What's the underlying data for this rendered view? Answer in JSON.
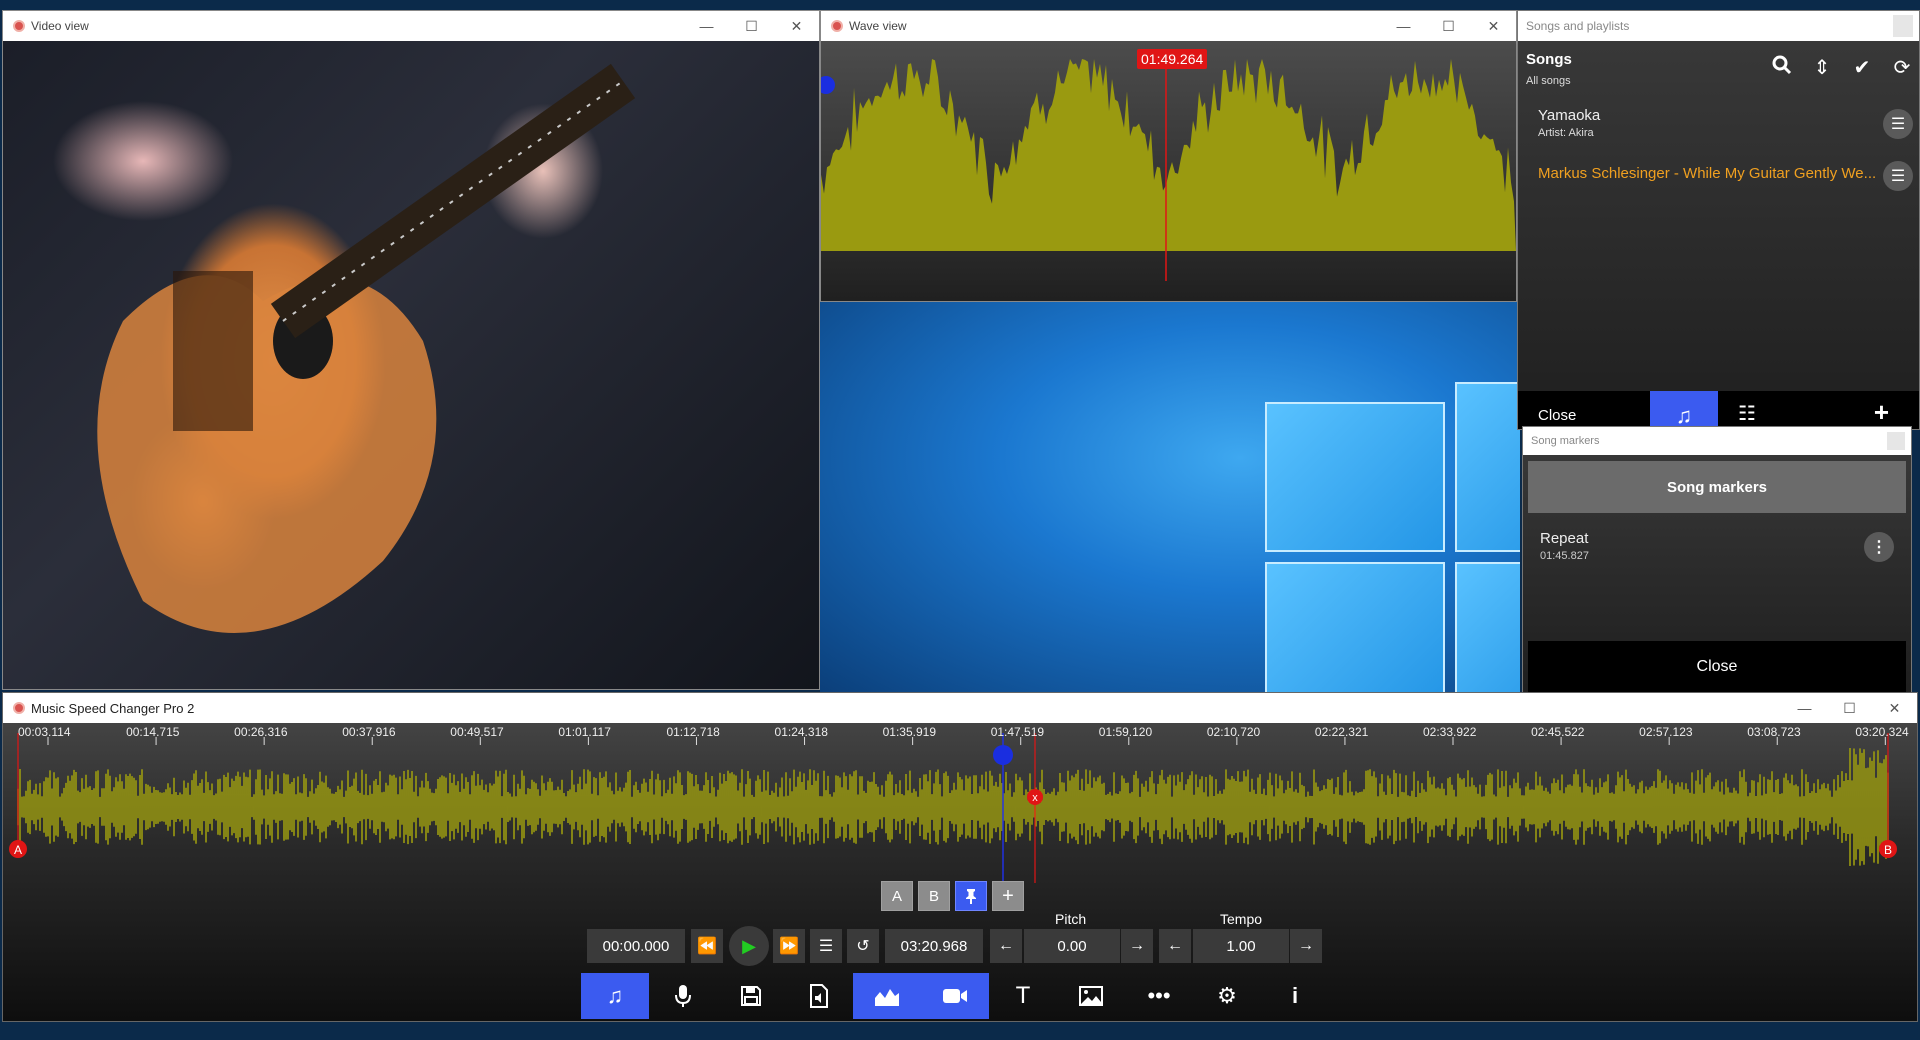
{
  "video_window": {
    "title": "Video view"
  },
  "wave_window": {
    "title": "Wave view",
    "playhead_time": "01:49.264"
  },
  "songs_window": {
    "title": "Songs and playlists",
    "heading": "Songs",
    "subheading": "All songs",
    "tools": [
      "search-icon",
      "sort-icon",
      "check-icon",
      "refresh-icon"
    ],
    "songs": [
      {
        "title": "Yamaoka",
        "artist": "Artist: Akira",
        "active": false
      },
      {
        "title": "Markus Schlesinger - While My Guitar Gently We...",
        "artist": "",
        "active": true
      }
    ],
    "close_label": "Close"
  },
  "markers_window": {
    "title": "Song markers",
    "heading": "Song markers",
    "marker": {
      "name": "Repeat",
      "time": "01:45.827"
    },
    "close_label": "Close"
  },
  "main_window": {
    "title": "Music Speed Changer Pro 2",
    "timeline_ticks": [
      "00:03.114",
      "00:14.715",
      "00:26.316",
      "00:37.916",
      "00:49.517",
      "01:01.117",
      "01:12.718",
      "01:24.318",
      "01:35.919",
      "01:47.519",
      "01:59.120",
      "02:10.720",
      "02:22.321",
      "02:33.922",
      "02:45.522",
      "02:57.123",
      "03:08.723",
      "03:20.324"
    ],
    "marker_a": "A",
    "marker_b": "B",
    "marker_x": "x",
    "ab_buttons": {
      "a": "A",
      "b": "B",
      "pin": "📌",
      "add": "+"
    },
    "start_time": "00:00.000",
    "end_time": "03:20.968",
    "pitch_label": "Pitch",
    "pitch_value": "0.00",
    "tempo_label": "Tempo",
    "tempo_value": "1.00",
    "toolbar": [
      "music-note-icon",
      "microphone-icon",
      "save-icon",
      "export-audio-icon",
      "wave-chart-icon",
      "video-camera-icon",
      "text-icon",
      "image-icon",
      "more-icon",
      "settings-icon",
      "info-icon"
    ]
  },
  "colors": {
    "accent": "#3b5bf0",
    "wave": "#9a9a10",
    "marker_red": "#e01515",
    "active_song": "#f0a020"
  }
}
